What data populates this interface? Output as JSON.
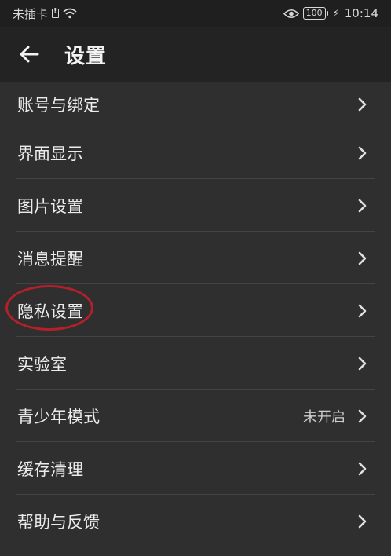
{
  "status_bar": {
    "carrier": "未插卡",
    "battery": "100",
    "time": "10:14",
    "icons": [
      "sim-alert-icon",
      "wifi-icon",
      "eye-icon",
      "battery-icon",
      "charging-icon"
    ]
  },
  "header": {
    "title": "设置",
    "back_icon": "arrow-left-icon"
  },
  "settings": {
    "items": [
      {
        "label": "账号与绑定",
        "value": ""
      },
      {
        "label": "界面显示",
        "value": ""
      },
      {
        "label": "图片设置",
        "value": ""
      },
      {
        "label": "消息提醒",
        "value": ""
      },
      {
        "label": "隐私设置",
        "value": "",
        "highlighted": true
      },
      {
        "label": "实验室",
        "value": ""
      },
      {
        "label": "青少年模式",
        "value": "未开启"
      },
      {
        "label": "缓存清理",
        "value": ""
      },
      {
        "label": "帮助与反馈",
        "value": ""
      }
    ]
  },
  "colors": {
    "background": "#2f2f2f",
    "header": "#232323",
    "status_bar": "#1f1f1f",
    "highlight": "#b3202b",
    "text": "#ececec"
  }
}
